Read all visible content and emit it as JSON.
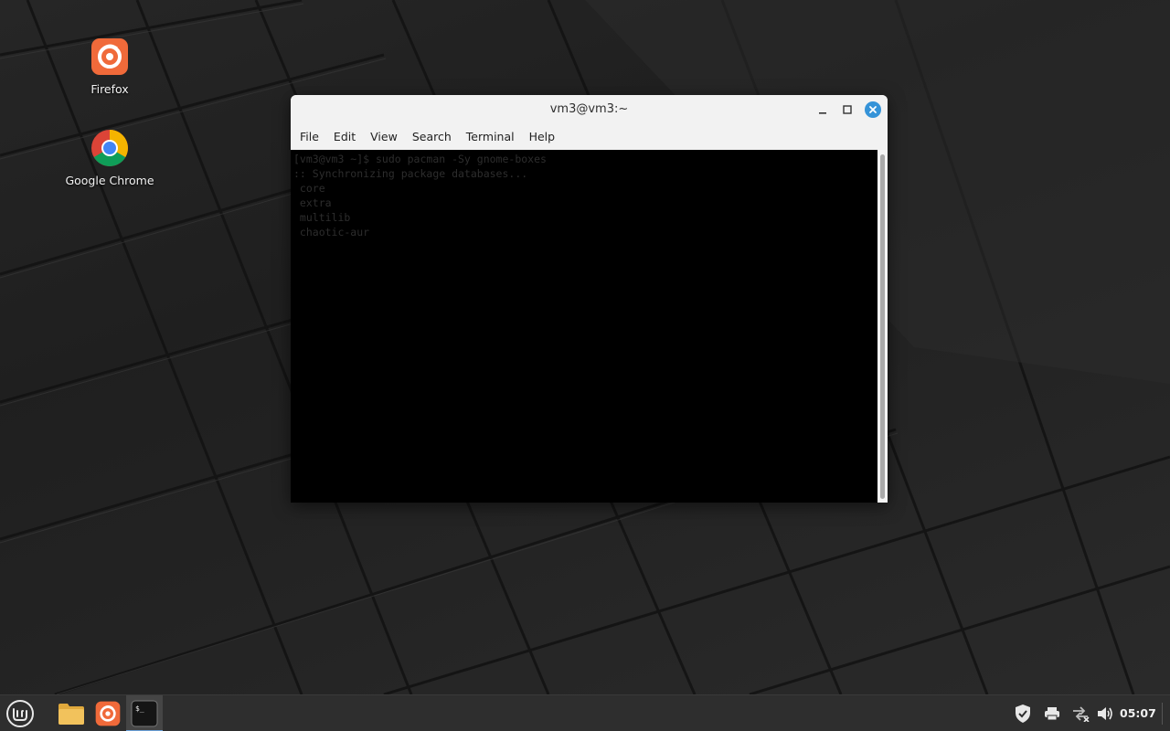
{
  "desktop": {
    "icons": [
      {
        "label": "Firefox",
        "icon": "firefox-icon"
      },
      {
        "label": "Google Chrome",
        "icon": "chrome-icon"
      }
    ]
  },
  "window": {
    "title": "vm3@vm3:~",
    "menu": [
      "File",
      "Edit",
      "View",
      "Search",
      "Terminal",
      "Help"
    ],
    "terminal_lines": [
      "[vm3@vm3 ~]$ sudo pacman -Sy gnome-boxes",
      ":: Synchronizing package databases...",
      " core",
      " extra",
      " multilib",
      " chaotic-aur"
    ]
  },
  "taskbar": {
    "items": [
      "mint-menu-icon",
      "files-icon",
      "firefox-icon",
      "terminal-icon"
    ],
    "tray": [
      "shield-icon",
      "printer-icon",
      "network-icon",
      "volume-icon"
    ],
    "clock": "05:07"
  },
  "colors": {
    "terminal_bg": "#000000",
    "close_button": "#3593d8",
    "firefox": "#f06a3a",
    "taskbar": "#2e2e2e"
  }
}
